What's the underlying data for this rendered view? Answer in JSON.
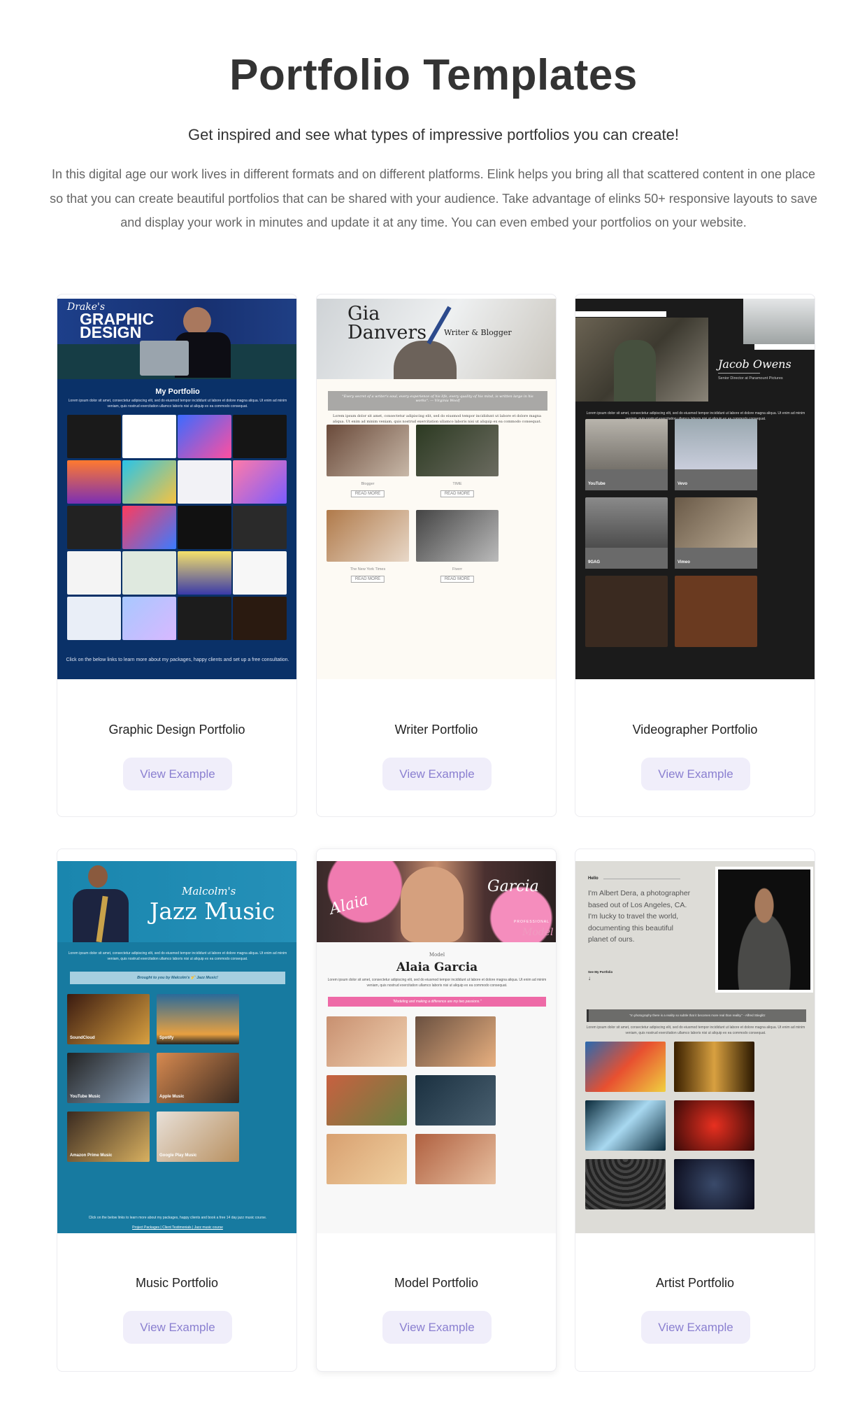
{
  "header": {
    "title": "Portfolio Templates",
    "subtitle": "Get inspired and see what types of impressive portfolios you can create!",
    "intro": "In this digital age our work lives in different formats and on different platforms. Elink helps you bring all that scattered content in one place so that you can create beautiful portfolios that can be shared with your audience. Take advantage of elinks 50+ responsive layouts to save and display your work in minutes and update it at any time. You can even embed your portfolios on your website."
  },
  "lorem": "Lorem ipsum dolor sit amet, consectetur adipiscing elit, sed do eiusmod tempor incididunt ut labore et dolore magna aliqua. Ut enim ad minim veniam, quis nostrud exercitation ullamco laboris nisi ut aliquip ex ea commodo consequat.",
  "button_label": "View Example",
  "cards": [
    {
      "caption": "Graphic Design Portfolio",
      "script": "Drake's",
      "headline1": "GRAPHIC",
      "headline2": "DESIGN",
      "section_title": "My Portfolio",
      "footer": "Click on the below links to learn more about my packages, happy clients and set up a free consultation."
    },
    {
      "caption": "Writer Portfolio",
      "name1": "Gia",
      "name2": "Danvers",
      "role": "Writer & Blogger",
      "quote": "\"Every secret of a writer's soul, every experience of his life, every quality of his mind, is written large in his works\". — Virginia Woolf",
      "labels": [
        "Blogger",
        "TIME",
        "The New York Times",
        "Fiverr"
      ],
      "read_more": "READ MORE"
    },
    {
      "caption": "Videographer Portfolio",
      "name": "Jacob Owens",
      "role": "Senior Director at Paramount Pictures",
      "labels": [
        "YouTube",
        "Vevo",
        "9GAG",
        "Vimeo"
      ]
    },
    {
      "caption": "Music Portfolio",
      "script": "Malcolm's",
      "headline": "Jazz Music",
      "banner": "Brought to you by Malcolm's 🎷 Jazz Music!",
      "labels": [
        "SoundCloud",
        "Spotify",
        "YouTube Music",
        "Apple Music",
        "Amazon Prime Music",
        "Google Play Music"
      ],
      "footer": "Click on the below links to learn more about my packages, happy clients and book a free 14 day jazz music course.",
      "links": "Project Packages | Client Testimonials | Jazz music course"
    },
    {
      "caption": "Model Portfolio",
      "script1": "Alaia",
      "script2": "Garcia",
      "tag": "PROFESSIONAL",
      "script3": "Model",
      "kicker": "Model",
      "name": "Alaia Garcia",
      "quote": "\"Modeling and making a difference are my two passions.\""
    },
    {
      "caption": "Artist Portfolio",
      "hello": "Hello",
      "intro": "I'm Albert Dera, a photographer based out of Los Angeles, CA. I'm lucky to travel the world, documenting this beautiful planet of ours.",
      "see": "See My Portfolio",
      "arrow": "↓",
      "quote": "\"In photography there is a reality so subtle that it becomes more real than reality.\" - Alfred Stieglitz"
    }
  ],
  "colors": {
    "button_bg": "#f0eefa",
    "button_text": "#8a7fd0",
    "heading": "#333333"
  }
}
